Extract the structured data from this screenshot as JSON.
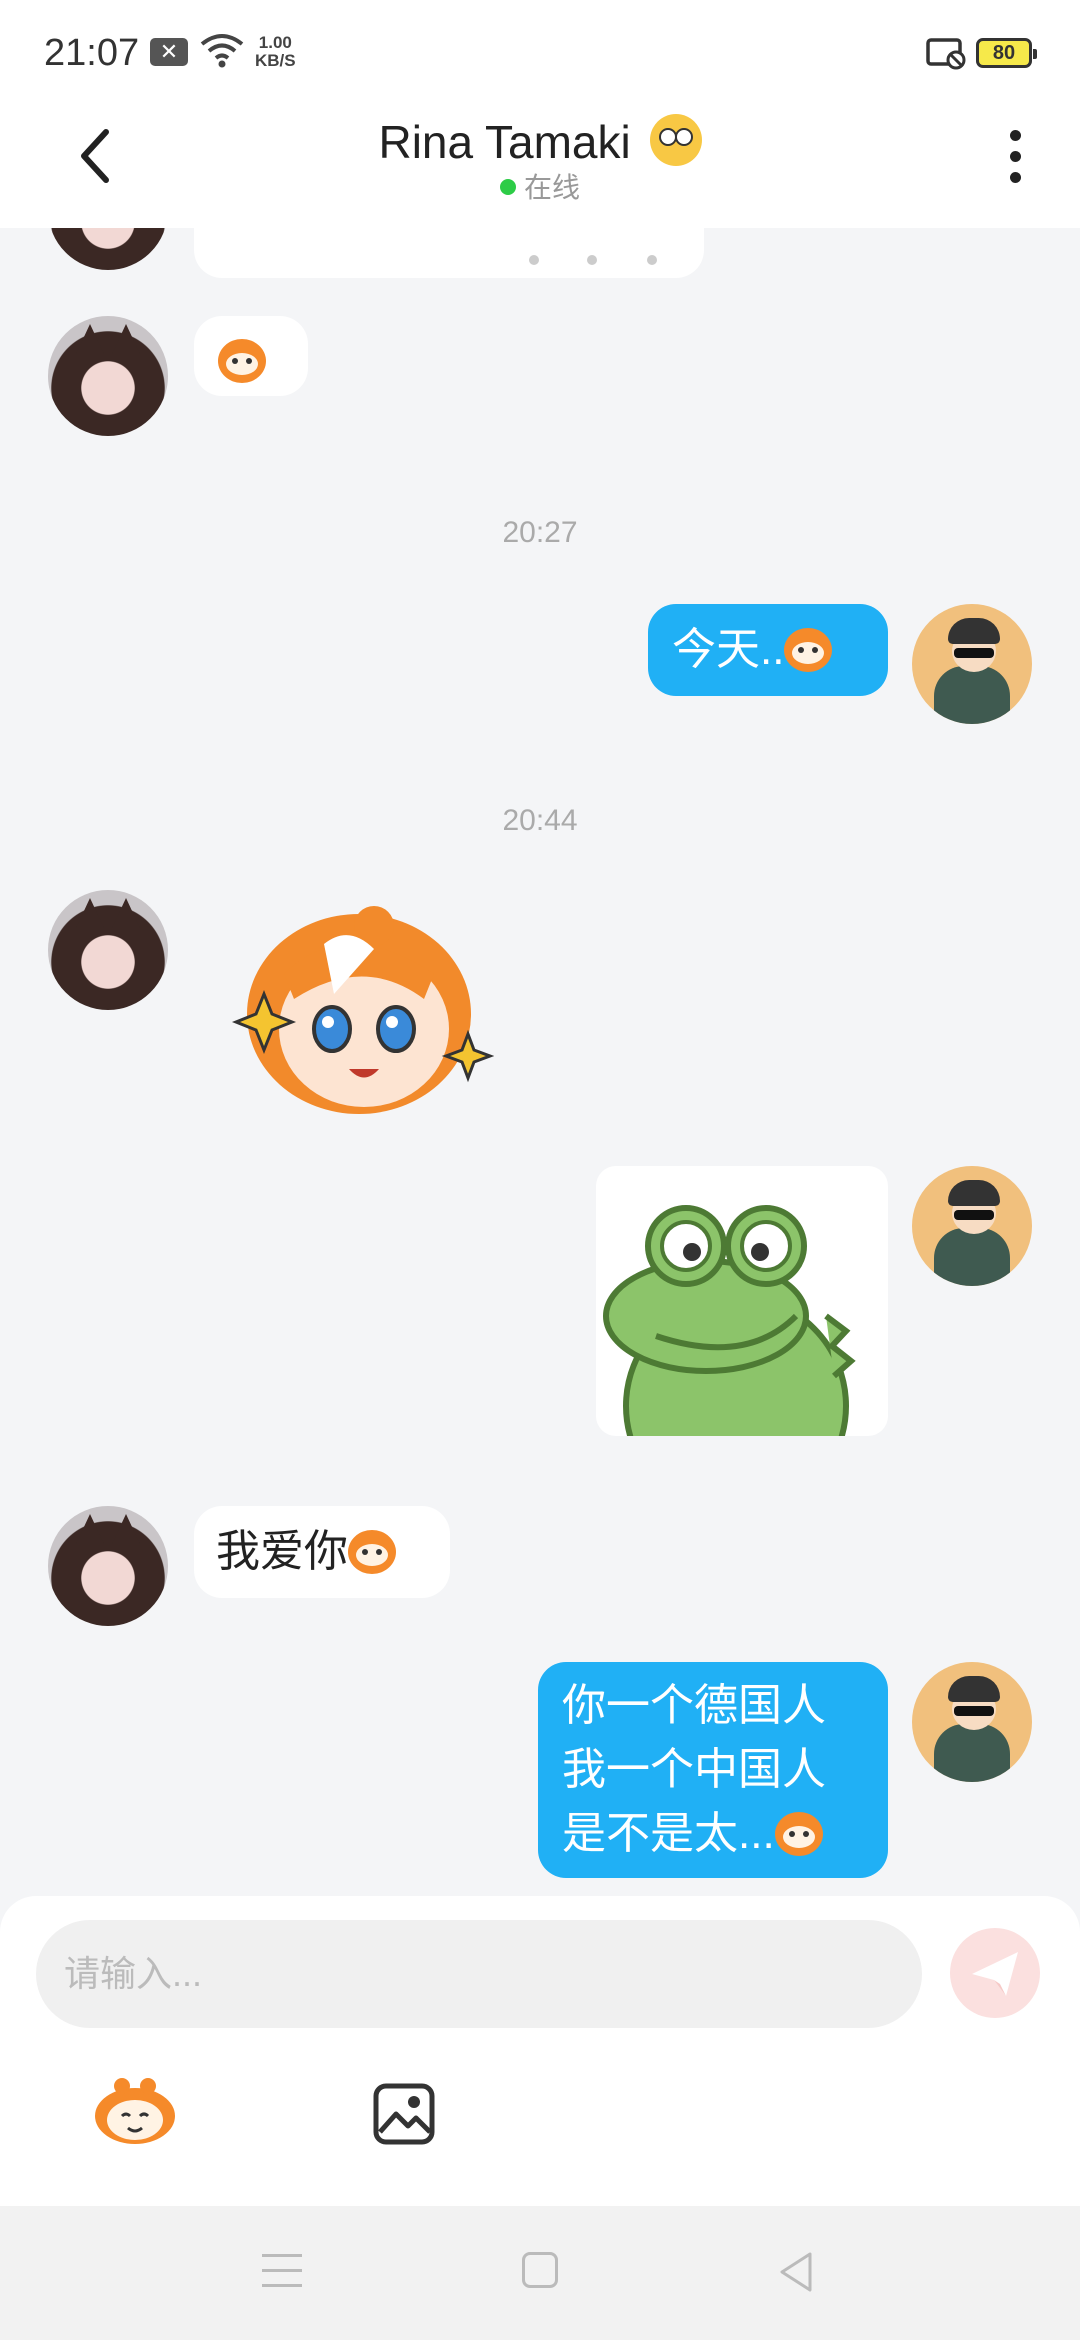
{
  "status_bar": {
    "time": "21:07",
    "notification_icon": "x-box-icon",
    "net_speed_value": "1.00",
    "net_speed_unit": "KB/S",
    "battery": "80"
  },
  "header": {
    "title": "Rina Tamaki",
    "title_emoji": "eye-roll-emoji",
    "status": "在线",
    "status_color": "#2dcc47"
  },
  "messages": {
    "time_1": "20:27",
    "time_2": "20:44",
    "out_1_text": "今天..",
    "in_text": "我爱你",
    "out_2_lines": [
      "你一个德国人",
      "我一个中国人",
      "是不是太..."
    ]
  },
  "input": {
    "placeholder": "请输入..."
  },
  "colors": {
    "outgoing_bubble": "#20b0f5",
    "incoming_bubble": "#ffffff",
    "background": "#f4f5f7"
  }
}
